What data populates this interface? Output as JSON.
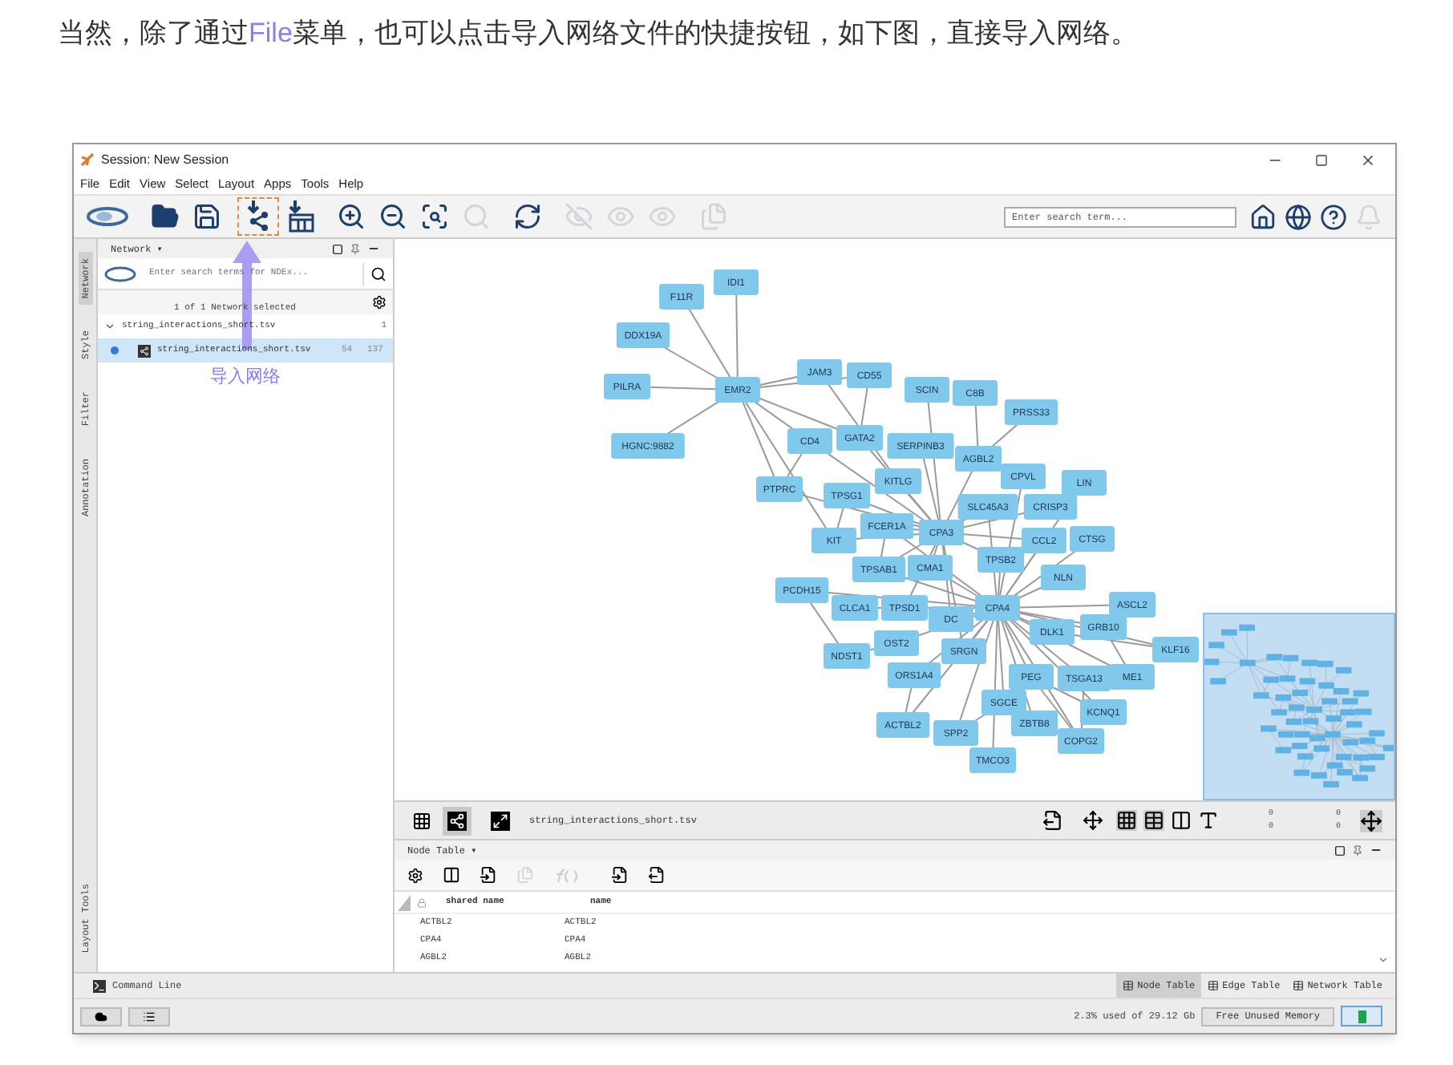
{
  "article": {
    "before": "当然，除了通过",
    "highlight": "File",
    "after": "菜单，也可以点击导入网络文件的快捷按钮，如下图，直接导入网络。"
  },
  "window": {
    "title": "Session: New Session"
  },
  "menu": [
    "File",
    "Edit",
    "View",
    "Select",
    "Layout",
    "Apps",
    "Tools",
    "Help"
  ],
  "toolbar": [
    {
      "kind": "logo",
      "disabled": false,
      "highlighted": false
    },
    {
      "kind": "open",
      "disabled": false,
      "highlighted": false
    },
    {
      "kind": "save",
      "disabled": false,
      "highlighted": false
    },
    {
      "kind": "import-network",
      "disabled": false,
      "highlighted": true
    },
    {
      "kind": "import-table",
      "disabled": false,
      "highlighted": false
    },
    {
      "kind": "zoom-in",
      "disabled": false,
      "highlighted": false
    },
    {
      "kind": "zoom-out",
      "disabled": false,
      "highlighted": false
    },
    {
      "kind": "zoom-fit",
      "disabled": false,
      "highlighted": false
    },
    {
      "kind": "zoom-selected",
      "disabled": true,
      "highlighted": false
    },
    {
      "kind": "refresh",
      "disabled": false,
      "highlighted": false
    },
    {
      "kind": "hide",
      "disabled": true,
      "highlighted": false
    },
    {
      "kind": "hide-show",
      "disabled": true,
      "highlighted": false
    },
    {
      "kind": "show",
      "disabled": true,
      "highlighted": false
    },
    {
      "kind": "document",
      "disabled": true,
      "highlighted": false
    }
  ],
  "search": {
    "placeholder": "Enter search term..."
  },
  "toolbar_right": [
    {
      "kind": "home",
      "disabled": false
    },
    {
      "kind": "globe",
      "disabled": false
    },
    {
      "kind": "help",
      "disabled": false
    },
    {
      "kind": "bell",
      "disabled": true
    }
  ],
  "annotation": {
    "label": "导入网络"
  },
  "side_tabs": [
    {
      "label": "Network",
      "selected": true
    },
    {
      "label": "Style",
      "selected": false
    },
    {
      "label": "Filter",
      "selected": false
    },
    {
      "label": "Annotation",
      "selected": false
    },
    {
      "label": "Layout Tools",
      "selected": false
    }
  ],
  "network_panel": {
    "title": "Network ▾",
    "search_placeholder": "Enter search terms for NDEx...",
    "status": "1 of 1 Network selected",
    "tree": [
      {
        "name": "string_interactions_short.tsv",
        "count": "1",
        "expanded": true,
        "children": [
          {
            "name": "string_interactions_short.tsv",
            "nodes": "54",
            "edges": "137",
            "selected": true
          }
        ]
      }
    ]
  },
  "graph": {
    "nodes": [
      "IDI1",
      "F11R",
      "DDX19A",
      "PILRA",
      "HGNC:9882",
      "EMR2",
      "JAM3",
      "CD55",
      "SCIN",
      "C8B",
      "PRSS33",
      "CD4",
      "GATA2",
      "SERPINB3",
      "AGBL2",
      "CPVL",
      "LIN",
      "PTPRC",
      "TPSG1",
      "KITLG",
      "SLC45A3",
      "CRISP3",
      "FCER1A",
      "CPA3",
      "KIT",
      "CCL2",
      "CTSG",
      "TPSB2",
      "TPSAB1",
      "CMA1",
      "NLN",
      "PCDH15",
      "CLCA1",
      "TPSD1",
      "DC",
      "CPA4",
      "ASCL2",
      "DLK1",
      "GRB10",
      "NDST1",
      "OST2",
      "SRGN",
      "ORS1A4",
      "PEG",
      "TSGA13",
      "ME1",
      "KLF16",
      "SGCE",
      "KCNQ1",
      "ZBTB8",
      "COPG2",
      "ACTBL2",
      "SPP2",
      "TMCO3"
    ]
  },
  "view_toolbar": {
    "modes": [
      {
        "kind": "grid",
        "selected": false
      },
      {
        "kind": "network",
        "selected": true
      }
    ],
    "file": "string_interactions_short.tsv",
    "counts": [
      "0",
      "0",
      "0",
      "0"
    ]
  },
  "table_panel": {
    "title": "Node Table ▾",
    "columns": [
      "shared name",
      "name"
    ],
    "rows": [
      [
        "ACTBL2",
        "ACTBL2"
      ],
      [
        "CPA4",
        "CPA4"
      ],
      [
        "AGBL2",
        "AGBL2"
      ]
    ]
  },
  "command_line": "Command Line",
  "bottom_tabs": [
    {
      "label": "Node Table",
      "selected": true
    },
    {
      "label": "Edge Table",
      "selected": false
    },
    {
      "label": "Network Table",
      "selected": false
    }
  ],
  "memory": {
    "usage": "2.3% used of 29.12 Gb",
    "button": "Free Unused Memory"
  }
}
